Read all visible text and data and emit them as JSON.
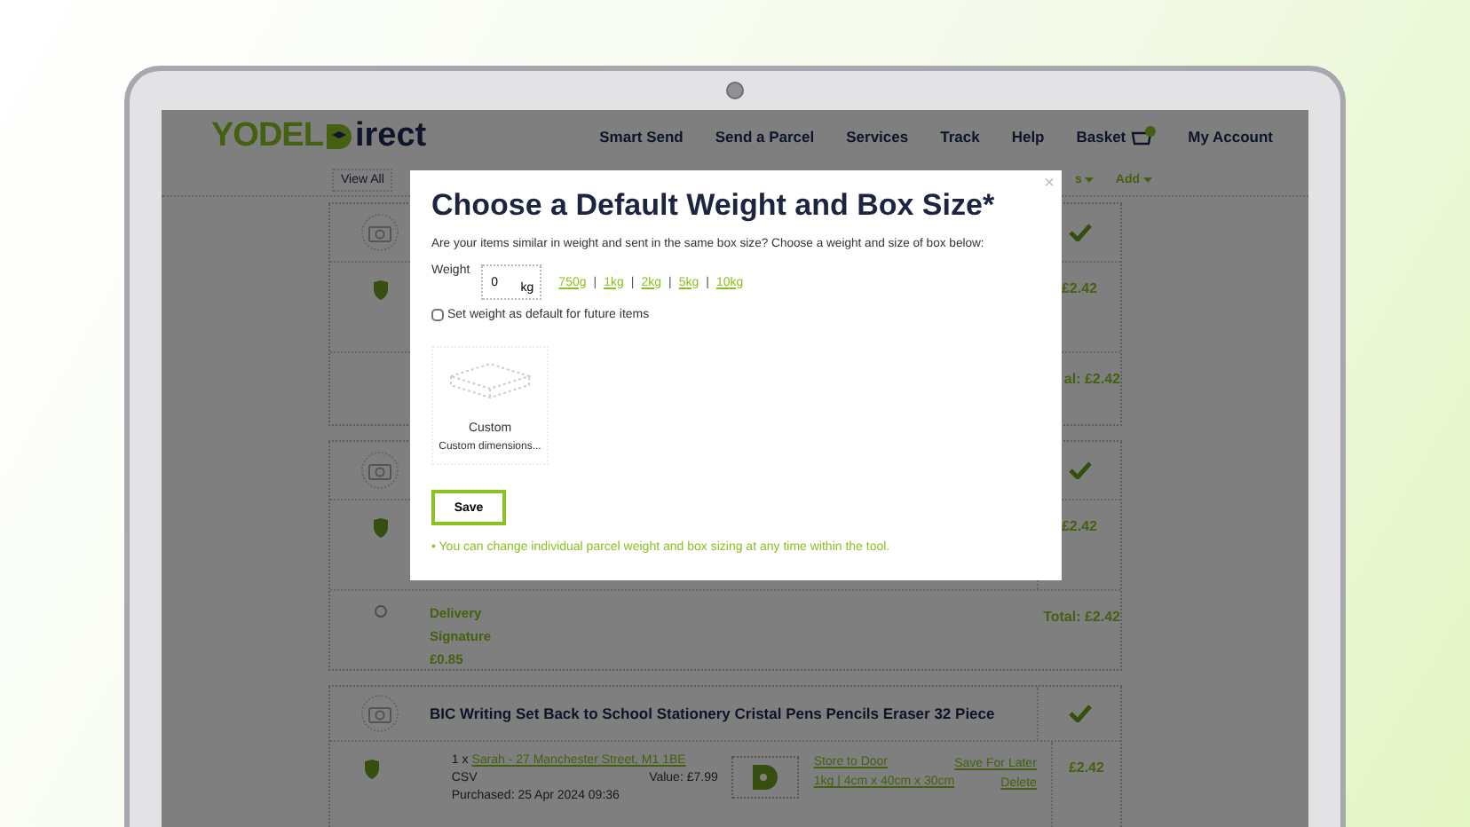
{
  "header": {
    "logo_word": "YODEL",
    "logo_suffix": "irect",
    "nav": [
      "Smart Send",
      "Send a Parcel",
      "Services",
      "Track",
      "Help"
    ],
    "basket": "Basket",
    "account": "My Account"
  },
  "subnav": {
    "view_all": "View All",
    "menus": [
      "s",
      "Add"
    ]
  },
  "parcels": [
    {
      "verified": true,
      "price": "£2.42",
      "total": "al: £2.42"
    },
    {
      "verified": true,
      "price": "£2.42",
      "delivery_options": [
        {
          "label": "Delivery",
          "selected": false,
          "lines": [
            "Signature",
            "£0.85"
          ]
        }
      ],
      "total": "Total: £2.42"
    },
    {
      "title": "BIC Writing Set Back to School Stationery Cristal Pens Pencils Eraser 32 Piece",
      "verified": true,
      "quantity": "1 x",
      "recipient": "Sarah - 27 Manchester Street, M1 1BE",
      "source": "CSV",
      "value": "Value: £7.99",
      "purchased": "Purchased: 25 Apr 2024 09:36",
      "service": "Store to Door",
      "dimensions": "1kg | 4cm x 40cm x 30cm",
      "actions": [
        "Save For Later",
        "Delete"
      ],
      "price": "£2.42"
    }
  ],
  "modal": {
    "close": "×",
    "title": "Choose a Default Weight and Box Size*",
    "description": "Are your items similar in weight and sent in the same box size? Choose a weight and size of box below:",
    "weight_label": "Weight",
    "weight_value": "0",
    "weight_unit": "kg",
    "presets": [
      "750g",
      "1kg",
      "2kg",
      "5kg",
      "10kg"
    ],
    "separator": "|",
    "default_checkbox": {
      "label": "Set weight as default for future items",
      "checked": false
    },
    "boxes": [
      {
        "name": "Custom",
        "description": "Custom dimensions...",
        "selected": false
      }
    ],
    "save": "Save",
    "note": "• You can change individual parcel weight and box sizing at any time within the tool."
  }
}
